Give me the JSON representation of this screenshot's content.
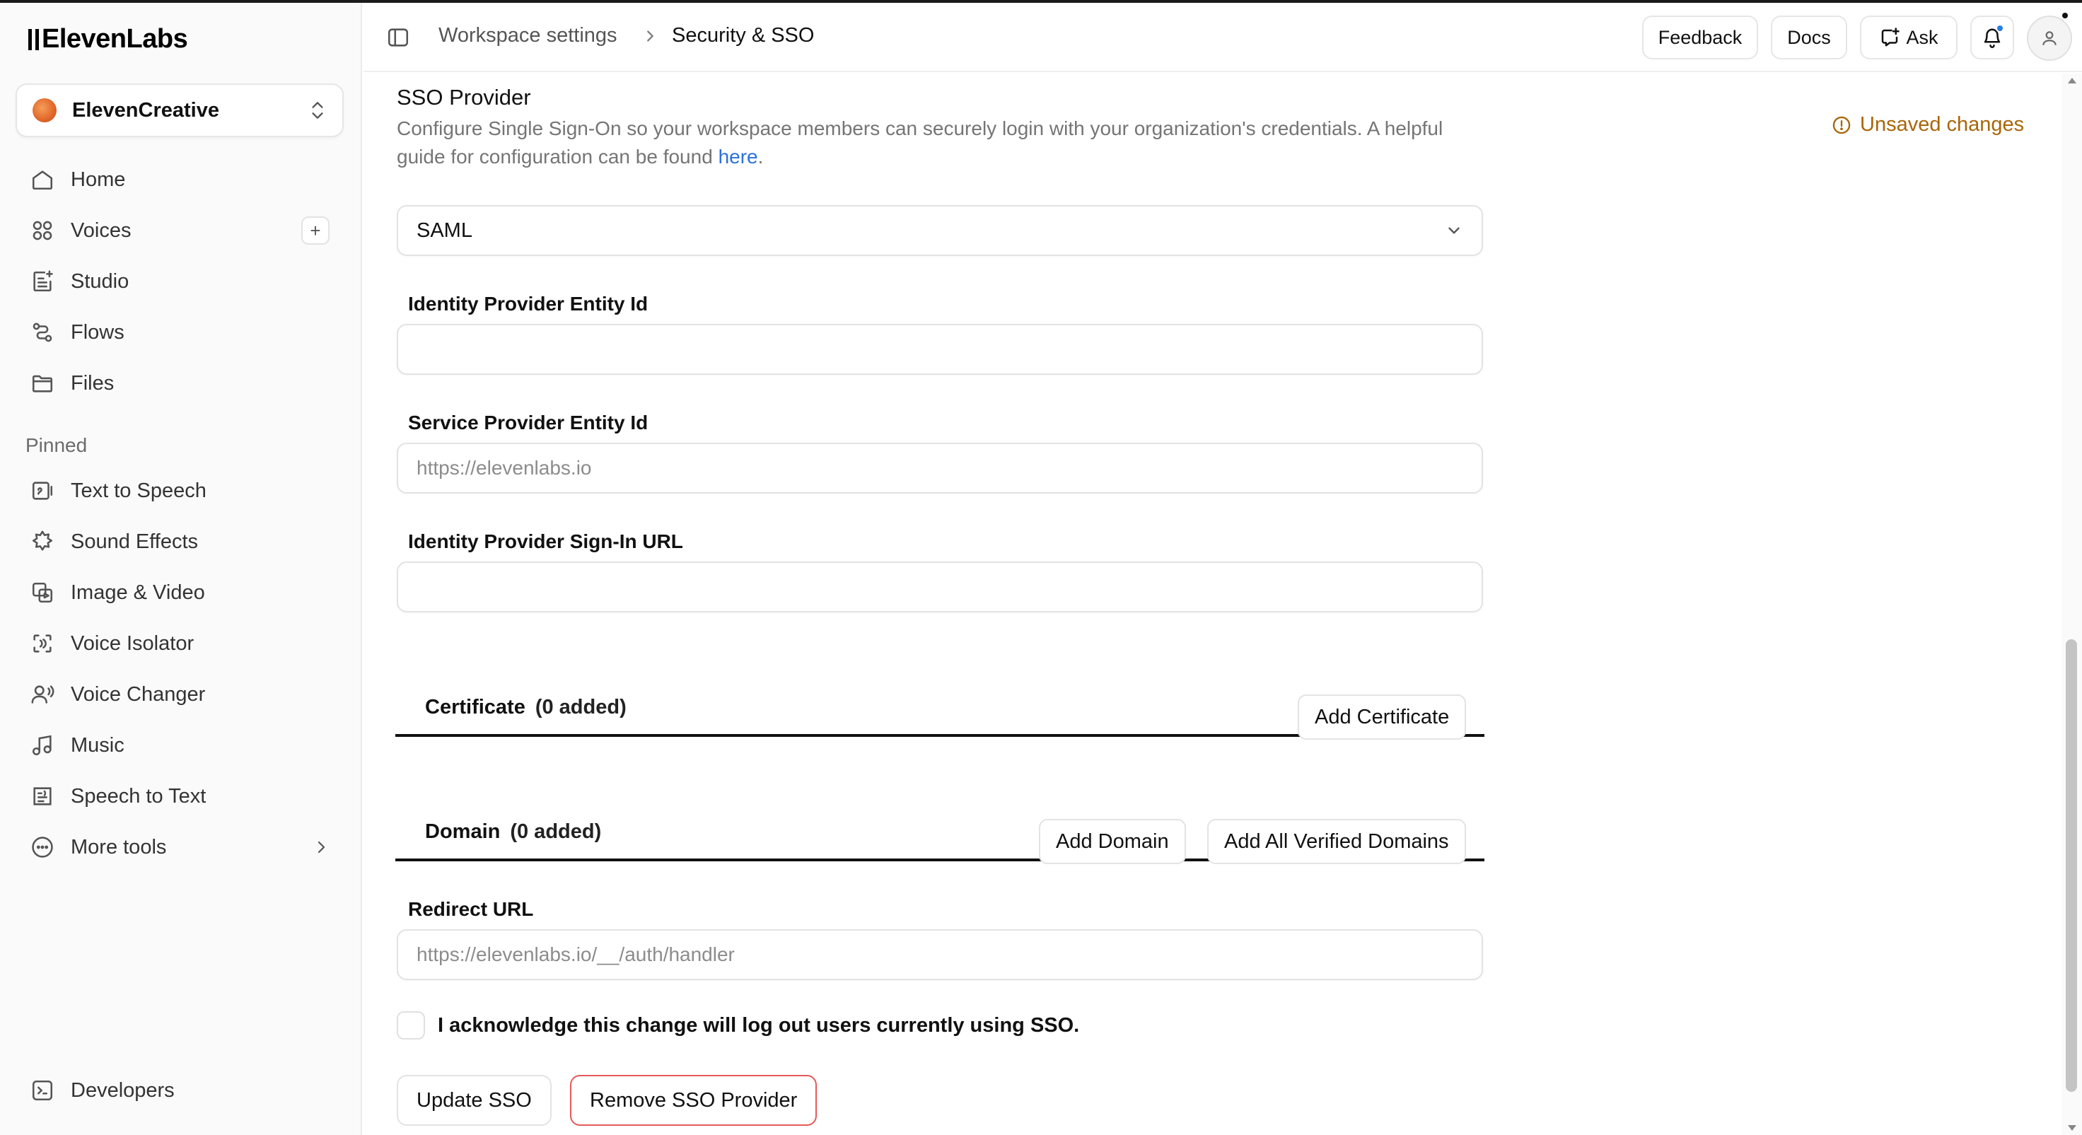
{
  "brand": {
    "name": "ElevenLabs"
  },
  "workspace": {
    "name": "ElevenCreative"
  },
  "sidebar": {
    "main_items": [
      {
        "label": "Home",
        "icon": "home-icon"
      },
      {
        "label": "Voices",
        "icon": "voices-icon",
        "add": "+"
      },
      {
        "label": "Studio",
        "icon": "studio-icon"
      },
      {
        "label": "Flows",
        "icon": "flows-icon"
      },
      {
        "label": "Files",
        "icon": "files-icon"
      }
    ],
    "pinned_title": "Pinned",
    "pinned_items": [
      {
        "label": "Text to Speech",
        "icon": "text-to-speech-icon"
      },
      {
        "label": "Sound Effects",
        "icon": "sound-effects-icon"
      },
      {
        "label": "Image & Video",
        "icon": "image-video-icon"
      },
      {
        "label": "Voice Isolator",
        "icon": "voice-isolator-icon"
      },
      {
        "label": "Voice Changer",
        "icon": "voice-changer-icon"
      },
      {
        "label": "Music",
        "icon": "music-icon"
      },
      {
        "label": "Speech to Text",
        "icon": "speech-to-text-icon"
      },
      {
        "label": "More tools",
        "icon": "more-tools-icon"
      }
    ],
    "footer_item": {
      "label": "Developers",
      "icon": "developers-icon"
    }
  },
  "header": {
    "breadcrumb": [
      "Workspace settings",
      "Security & SSO"
    ],
    "feedback_label": "Feedback",
    "docs_label": "Docs",
    "ask_label": "Ask"
  },
  "main": {
    "title": "SSO Provider",
    "description": "Configure Single Sign-On so your workspace members can securely login with your organization's credentials. A helpful guide for configuration can be found ",
    "description_link": "here",
    "description_end": ".",
    "unsaved_label": "Unsaved changes",
    "provider_type": "SAML",
    "fields": {
      "idp_entity_id": {
        "label": "Identity Provider Entity Id",
        "value": "",
        "placeholder": ""
      },
      "sp_entity_id": {
        "label": "Service Provider Entity Id",
        "value": "",
        "placeholder": "https://elevenlabs.io"
      },
      "idp_signin_url": {
        "label": "Identity Provider Sign-In URL",
        "value": "",
        "placeholder": ""
      },
      "redirect_url": {
        "label": "Redirect URL",
        "value": "",
        "placeholder": "https://elevenlabs.io/__/auth/handler"
      }
    },
    "certificate": {
      "title": "Certificate",
      "count": "(0 added)",
      "add_label": "Add Certificate"
    },
    "domain": {
      "title": "Domain",
      "count": "(0 added)",
      "add_label": "Add Domain",
      "add_all_label": "Add All Verified Domains"
    },
    "acknowledge_label": "I acknowledge this change will log out users currently using SSO.",
    "update_label": "Update SSO",
    "remove_label": "Remove SSO Provider"
  },
  "colors": {
    "unsaved": "#a8660a",
    "link": "#2a72d8",
    "danger_border": "#e45a5a",
    "notification_dot": "#2a7de1"
  }
}
